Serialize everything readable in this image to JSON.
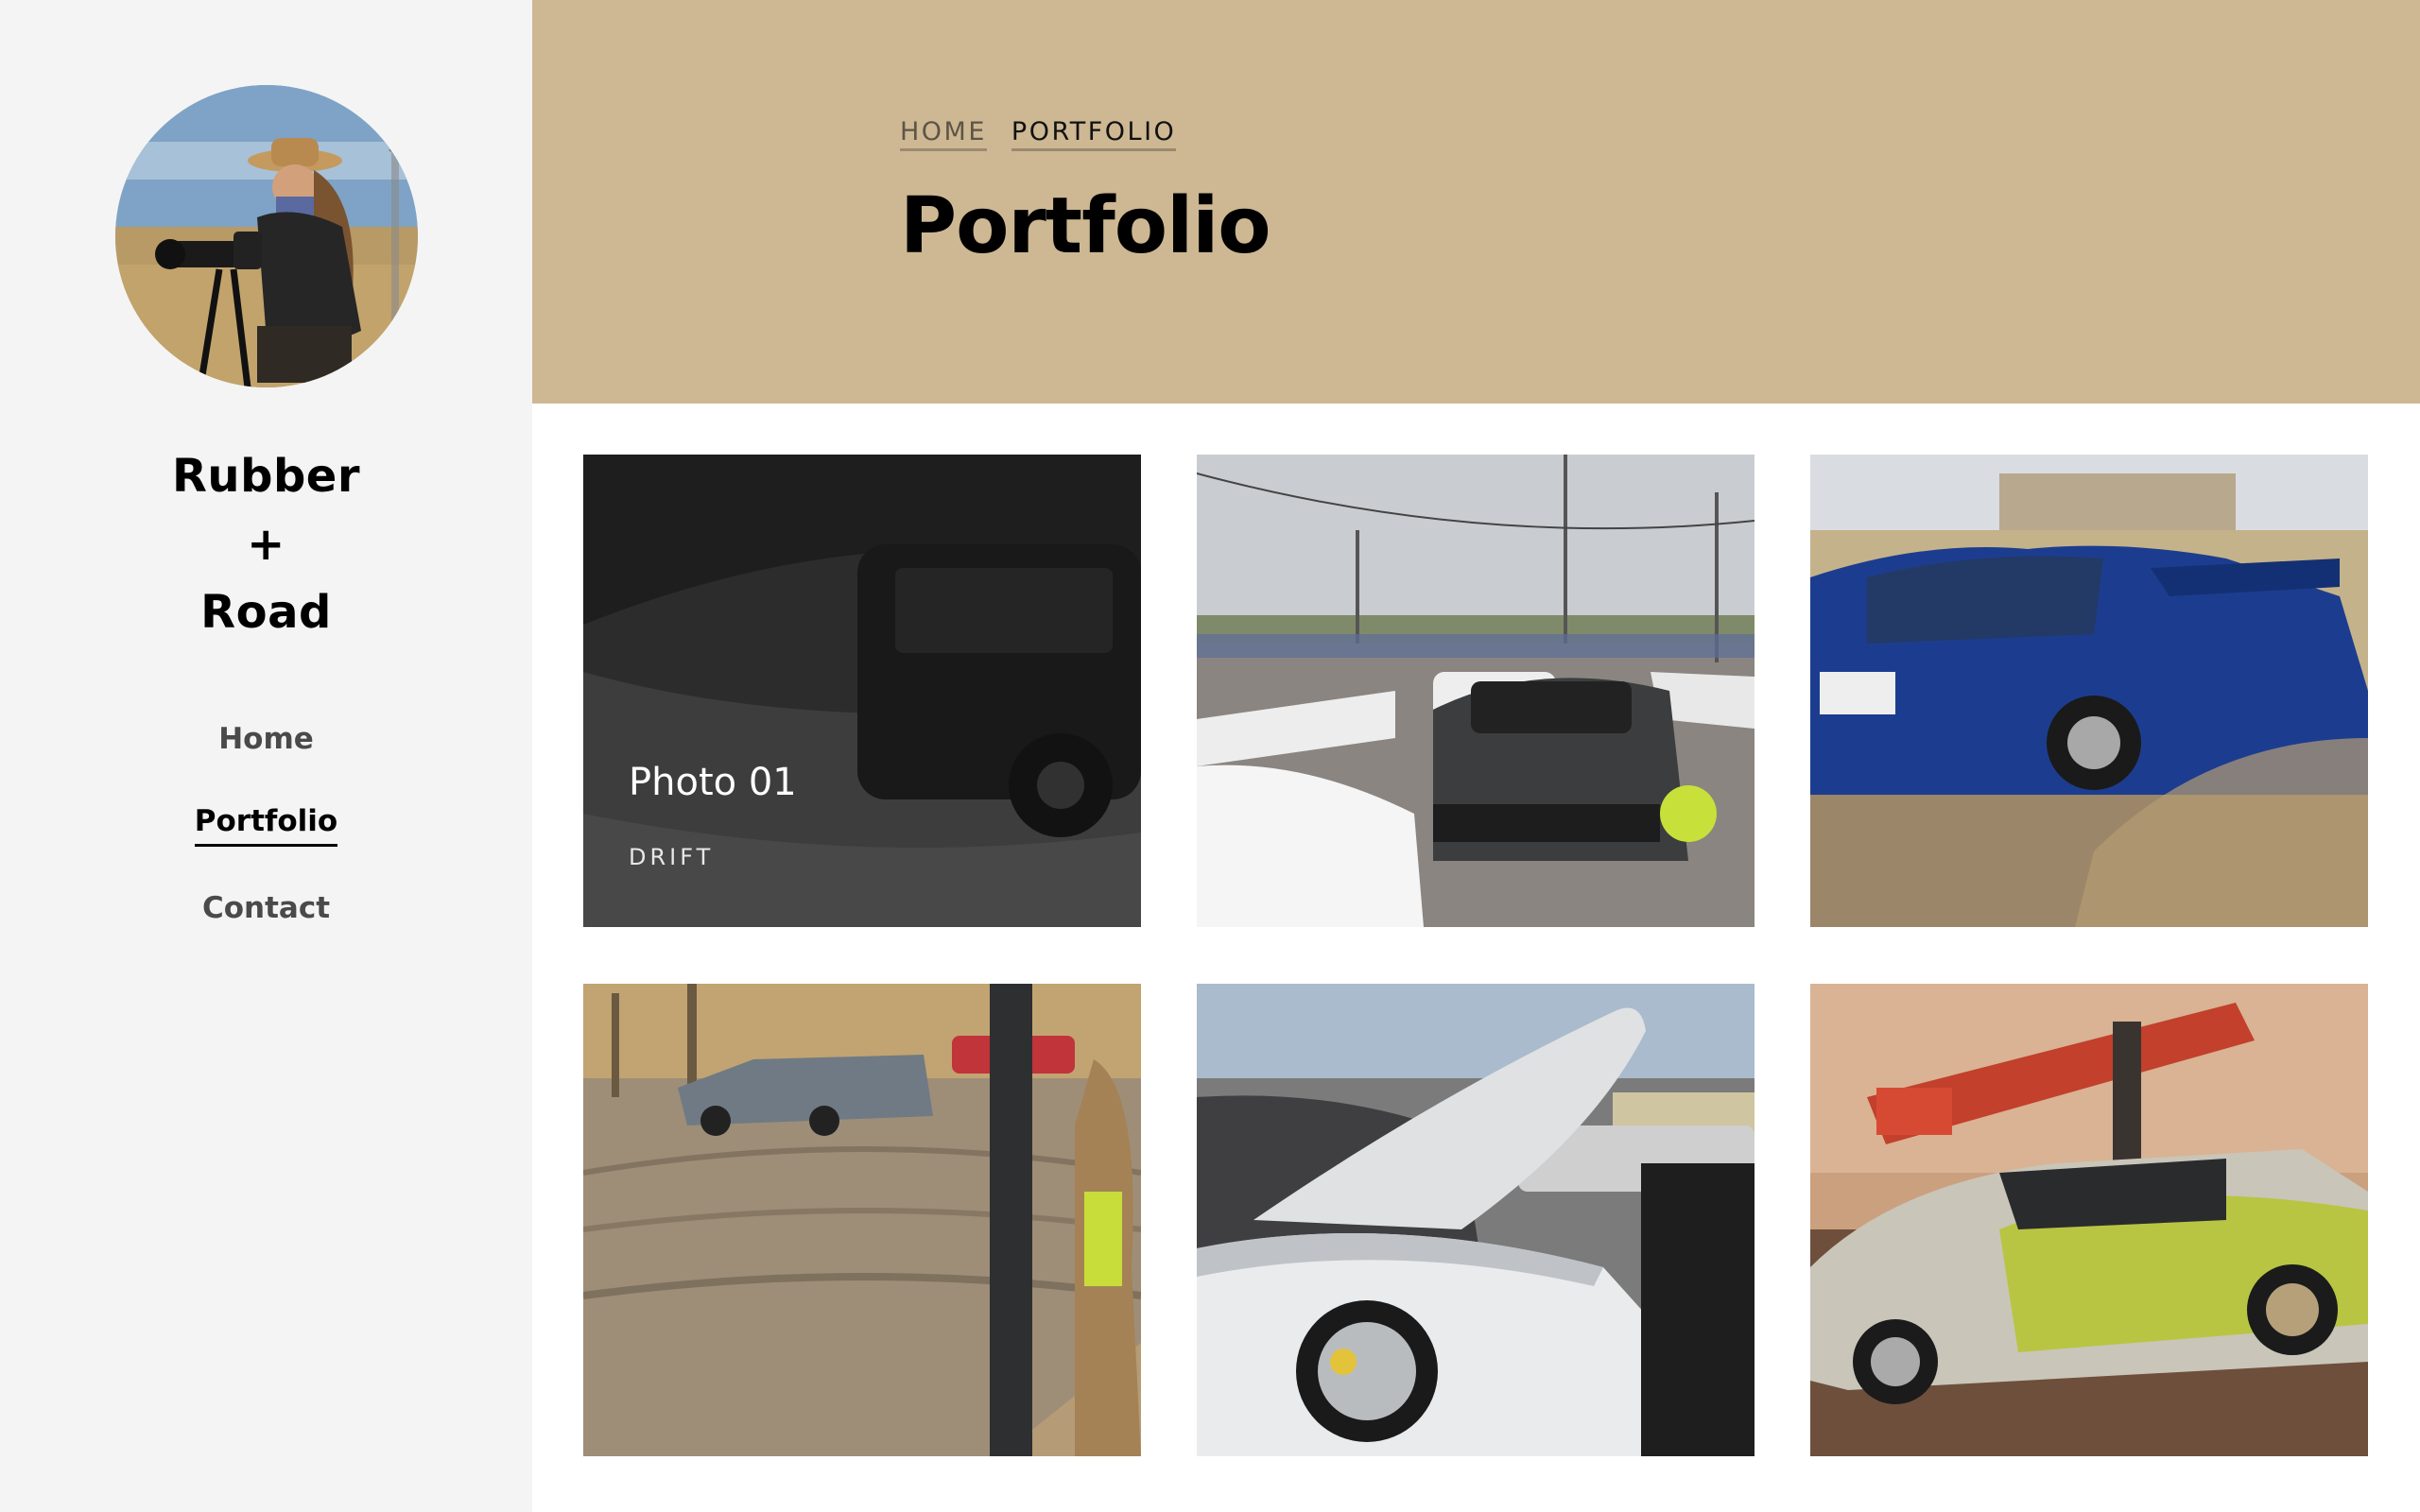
{
  "sidebar": {
    "title_line1": "Rubber",
    "title_line2": "+",
    "title_line3": "Road",
    "nav": [
      {
        "label": "Home"
      },
      {
        "label": "Portfolio"
      },
      {
        "label": "Contact"
      }
    ]
  },
  "header": {
    "breadcrumb": [
      {
        "label": "HOME"
      },
      {
        "label": "PORTFOLIO"
      }
    ],
    "title": "Portfolio",
    "background_color": "#cdb893"
  },
  "grid": {
    "items": [
      {
        "title": "Photo 01",
        "category": "DRIFT",
        "image": "blurred-van-drift-photo"
      },
      {
        "image": "drift-event-paddock-photo"
      },
      {
        "image": "blue-subaru-rally-photo"
      },
      {
        "image": "wagon-drifting-dirt-lot-photo"
      },
      {
        "image": "white-car-hood-open-photo"
      },
      {
        "image": "drift-doctor-livery-car-photo"
      }
    ]
  }
}
